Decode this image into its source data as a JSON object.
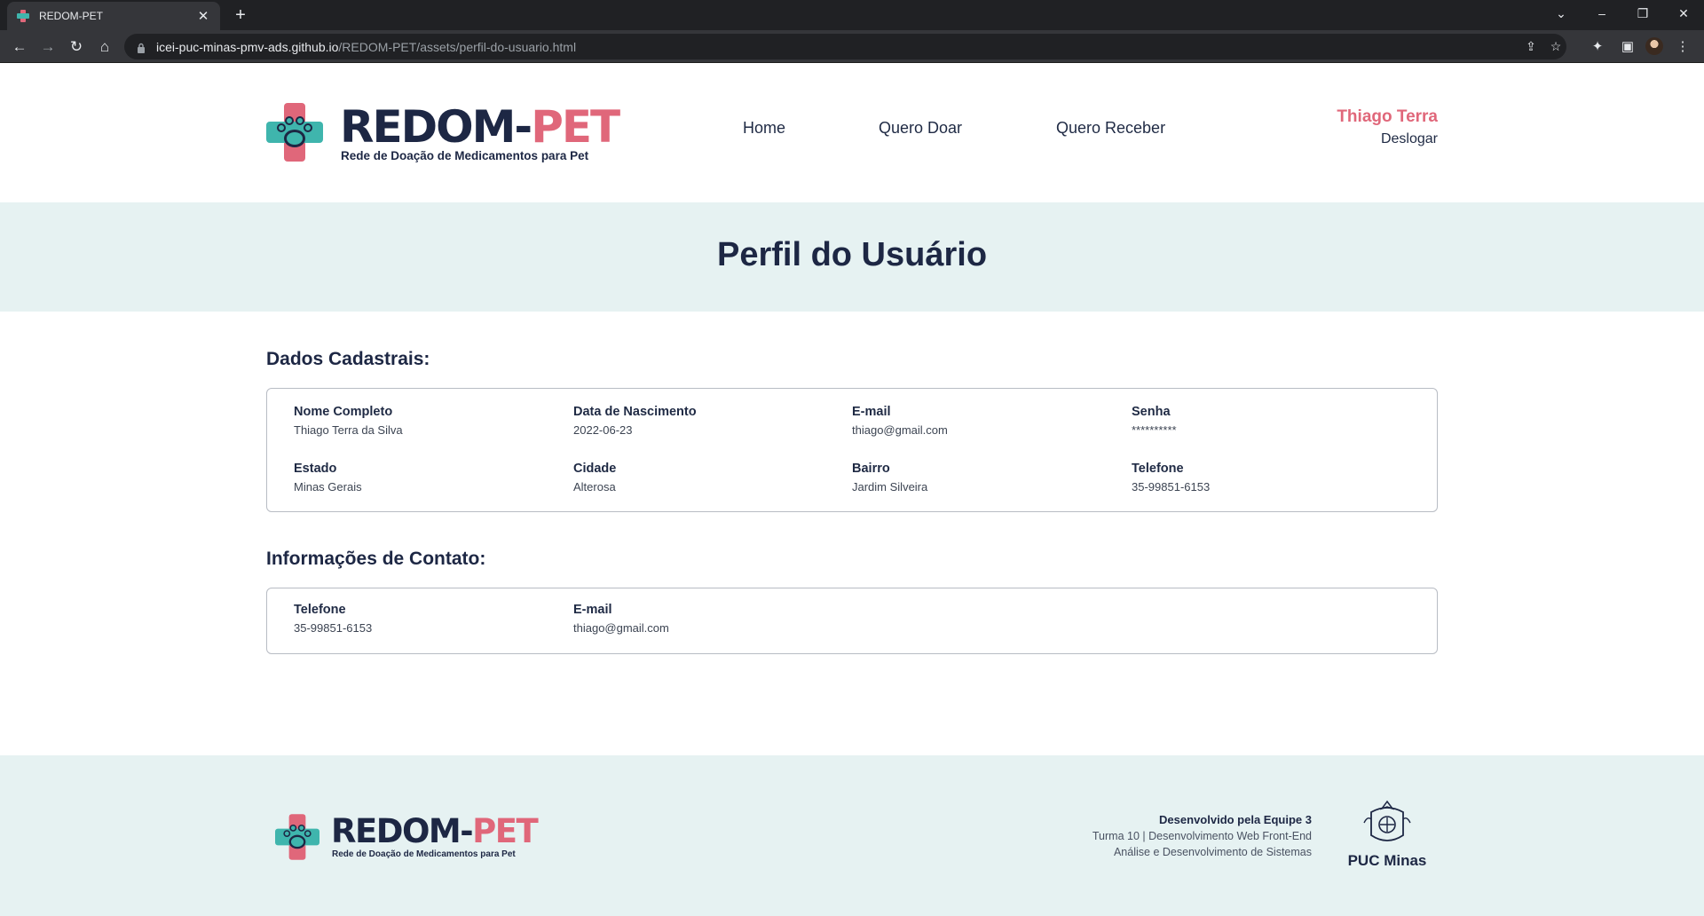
{
  "browser": {
    "tab_title": "REDOM-PET",
    "url_host": "icei-puc-minas-pmv-ads.github.io",
    "url_path": "/REDOM-PET/assets/perfil-do-usuario.html"
  },
  "header": {
    "logo_redom": "REDOM-",
    "logo_pet": "PET",
    "logo_subtitle": "Rede de Doação de Medicamentos para Pet",
    "nav": [
      "Home",
      "Quero Doar",
      "Quero Receber"
    ],
    "user_name": "Thiago Terra",
    "logout_label": "Deslogar"
  },
  "banner": {
    "title": "Perfil do Usuário"
  },
  "registration": {
    "title": "Dados Cadastrais:",
    "fields": [
      {
        "label": "Nome Completo",
        "value": "Thiago Terra da Silva"
      },
      {
        "label": "Data de Nascimento",
        "value": "2022-06-23"
      },
      {
        "label": "E-mail",
        "value": "thiago@gmail.com"
      },
      {
        "label": "Senha",
        "value": "**********"
      },
      {
        "label": "Estado",
        "value": "Minas Gerais"
      },
      {
        "label": "Cidade",
        "value": "Alterosa"
      },
      {
        "label": "Bairro",
        "value": "Jardim Silveira"
      },
      {
        "label": "Telefone",
        "value": "35-99851-6153"
      }
    ]
  },
  "contact": {
    "title": "Informações de Contato:",
    "fields": [
      {
        "label": "Telefone",
        "value": "35-99851-6153"
      },
      {
        "label": "E-mail",
        "value": "thiago@gmail.com"
      }
    ]
  },
  "footer": {
    "logo_redom": "REDOM-",
    "logo_pet": "PET",
    "logo_subtitle": "Rede de Doação de Medicamentos para Pet",
    "credit_line1": "Desenvolvido pela Equipe 3",
    "credit_line2": "Turma 10 | Desenvolvimento Web Front-End",
    "credit_line3": "Análise e Desenvolvimento de Sistemas",
    "puc_label": "PUC Minas"
  },
  "colors": {
    "brand_navy": "#1d2744",
    "brand_pink": "#e0677a",
    "brand_teal": "#3fb5ad",
    "banner_bg": "#e6f2f2"
  }
}
